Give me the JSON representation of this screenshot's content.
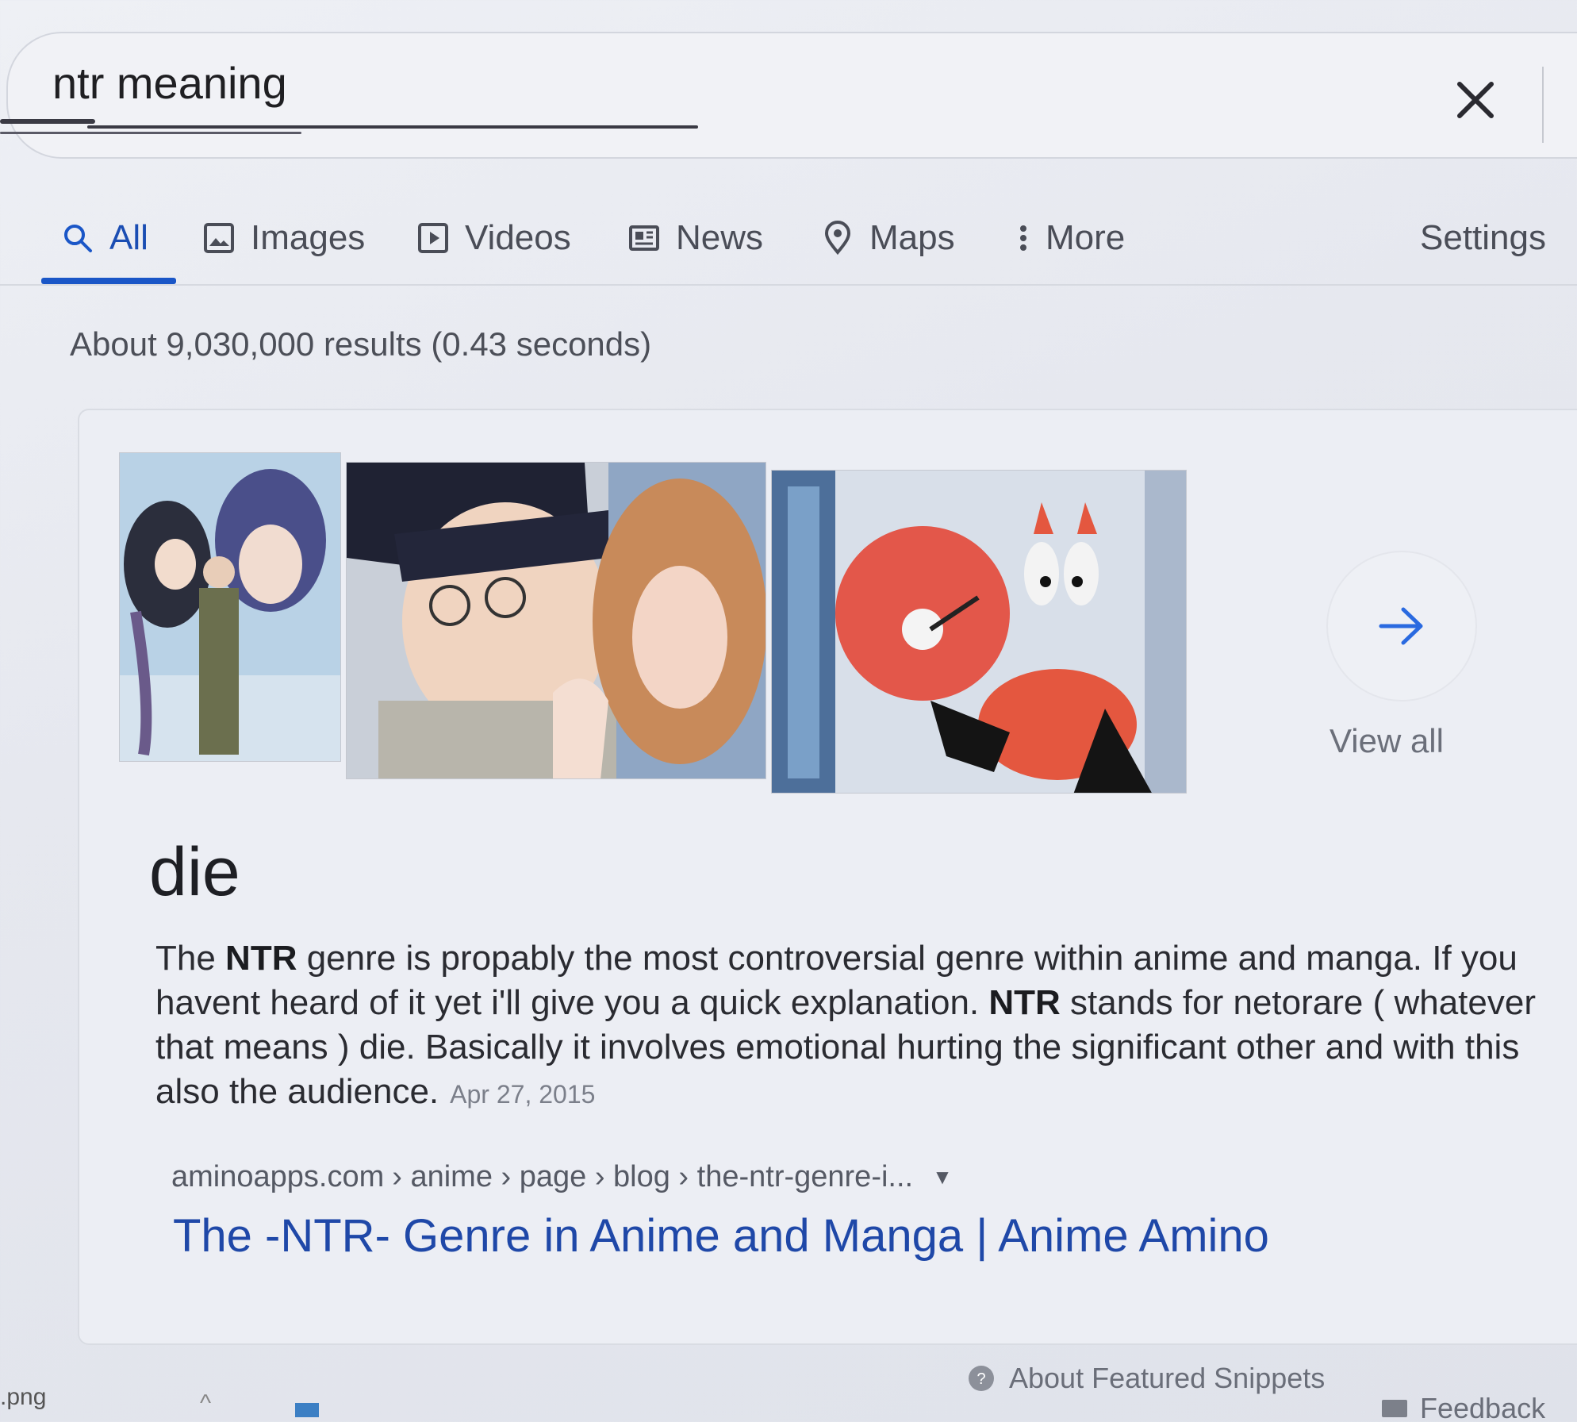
{
  "search": {
    "query": "ntr meaning",
    "clear_icon": "close-icon"
  },
  "tabs": [
    {
      "label": "All",
      "icon": "search-icon",
      "active": true
    },
    {
      "label": "Images",
      "icon": "image-icon"
    },
    {
      "label": "Videos",
      "icon": "video-icon"
    },
    {
      "label": "News",
      "icon": "news-icon"
    },
    {
      "label": "Maps",
      "icon": "map-pin-icon"
    },
    {
      "label": "More",
      "icon": "more-vert-icon"
    }
  ],
  "settings_label": "Settings",
  "result_stats": "About 9,030,000 results (0.43 seconds)",
  "featured": {
    "view_all_label": "View all",
    "answer": "die",
    "snippet": {
      "p1": "The ",
      "b1": "NTR",
      "p2": " genre is propably the most controversial genre within anime and manga. If you havent heard of it yet i'll give you a quick explanation. ",
      "b2": "NTR",
      "p3": " stands for netorare ( whatever that means ) die. Basically it involves emotional hurting the significant other and with this also the audience.",
      "date": "Apr 27, 2015"
    },
    "cite": {
      "domain": "aminoapps.com",
      "path": "› anime › page › blog › the-ntr-genre-i..."
    },
    "result_title": "The -NTR- Genre in Anime and Manga | Anime Amino"
  },
  "footer": {
    "about_label": "About Featured Snippets",
    "feedback_label": "Feedback"
  },
  "taskbar": {
    "file_label": ".png"
  },
  "colors": {
    "accent": "#1a56c7",
    "link": "#1f48a8"
  }
}
